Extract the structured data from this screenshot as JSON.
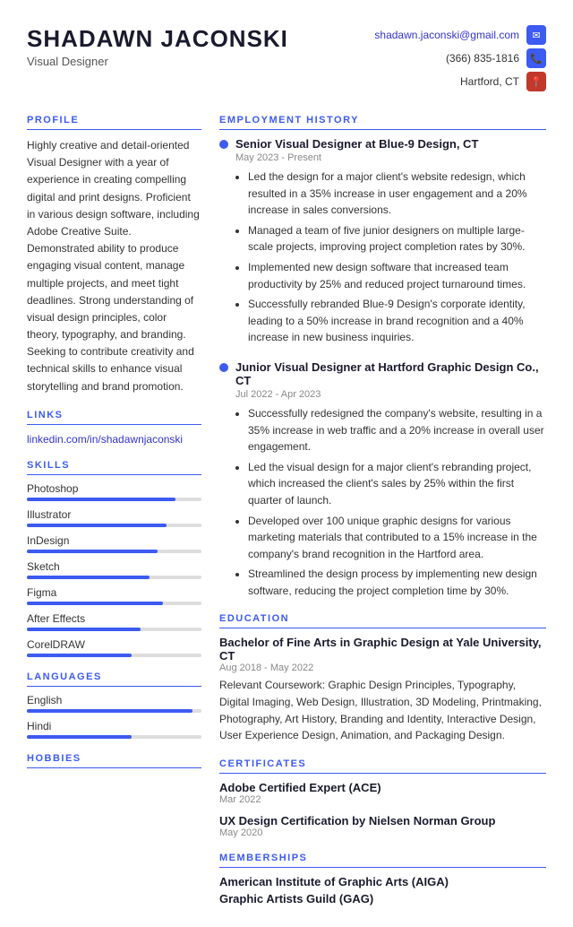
{
  "header": {
    "name": "SHADAWN JACONSKI",
    "title": "Visual Designer",
    "email": "shadawn.jaconski@gmail.com",
    "phone": "(366) 835-1816",
    "location": "Hartford, CT"
  },
  "profile": {
    "section_title": "PROFILE",
    "text": "Highly creative and detail-oriented Visual Designer with a year of experience in creating compelling digital and print designs. Proficient in various design software, including Adobe Creative Suite. Demonstrated ability to produce engaging visual content, manage multiple projects, and meet tight deadlines. Strong understanding of visual design principles, color theory, typography, and branding. Seeking to contribute creativity and technical skills to enhance visual storytelling and brand promotion."
  },
  "links": {
    "section_title": "LINKS",
    "items": [
      {
        "label": "linkedin.com/in/shadawnjaconski",
        "url": "#"
      }
    ]
  },
  "skills": {
    "section_title": "SKILLS",
    "items": [
      {
        "name": "Photoshop",
        "pct": 85
      },
      {
        "name": "Illustrator",
        "pct": 80
      },
      {
        "name": "InDesign",
        "pct": 75
      },
      {
        "name": "Sketch",
        "pct": 70
      },
      {
        "name": "Figma",
        "pct": 78
      },
      {
        "name": "After Effects",
        "pct": 65
      },
      {
        "name": "CorelDRAW",
        "pct": 60
      }
    ]
  },
  "languages": {
    "section_title": "LANGUAGES",
    "items": [
      {
        "name": "English",
        "pct": 95
      },
      {
        "name": "Hindi",
        "pct": 60
      }
    ]
  },
  "hobbies": {
    "section_title": "HOBBIES"
  },
  "employment": {
    "section_title": "EMPLOYMENT HISTORY",
    "jobs": [
      {
        "title": "Senior Visual Designer at Blue-9 Design, CT",
        "date": "May 2023 - Present",
        "bullets": [
          "Led the design for a major client's website redesign, which resulted in a 35% increase in user engagement and a 20% increase in sales conversions.",
          "Managed a team of five junior designers on multiple large-scale projects, improving project completion rates by 30%.",
          "Implemented new design software that increased team productivity by 25% and reduced project turnaround times.",
          "Successfully rebranded Blue-9 Design's corporate identity, leading to a 50% increase in brand recognition and a 40% increase in new business inquiries."
        ]
      },
      {
        "title": "Junior Visual Designer at Hartford Graphic Design Co., CT",
        "date": "Jul 2022 - Apr 2023",
        "bullets": [
          "Successfully redesigned the company's website, resulting in a 35% increase in web traffic and a 20% increase in overall user engagement.",
          "Led the visual design for a major client's rebranding project, which increased the client's sales by 25% within the first quarter of launch.",
          "Developed over 100 unique graphic designs for various marketing materials that contributed to a 15% increase in the company's brand recognition in the Hartford area.",
          "Streamlined the design process by implementing new design software, reducing the project completion time by 30%."
        ]
      }
    ]
  },
  "education": {
    "section_title": "EDUCATION",
    "degree": "Bachelor of Fine Arts in Graphic Design at Yale University, CT",
    "date": "Aug 2018 - May 2022",
    "desc": "Relevant Coursework: Graphic Design Principles, Typography, Digital Imaging, Web Design, Illustration, 3D Modeling, Printmaking, Photography, Art History, Branding and Identity, Interactive Design, User Experience Design, Animation, and Packaging Design."
  },
  "certificates": {
    "section_title": "CERTIFICATES",
    "items": [
      {
        "title": "Adobe Certified Expert (ACE)",
        "date": "Mar 2022"
      },
      {
        "title": "UX Design Certification by Nielsen Norman Group",
        "date": "May 2020"
      }
    ]
  },
  "memberships": {
    "section_title": "MEMBERSHIPS",
    "items": [
      "American Institute of Graphic Arts (AIGA)",
      "Graphic Artists Guild (GAG)"
    ]
  }
}
